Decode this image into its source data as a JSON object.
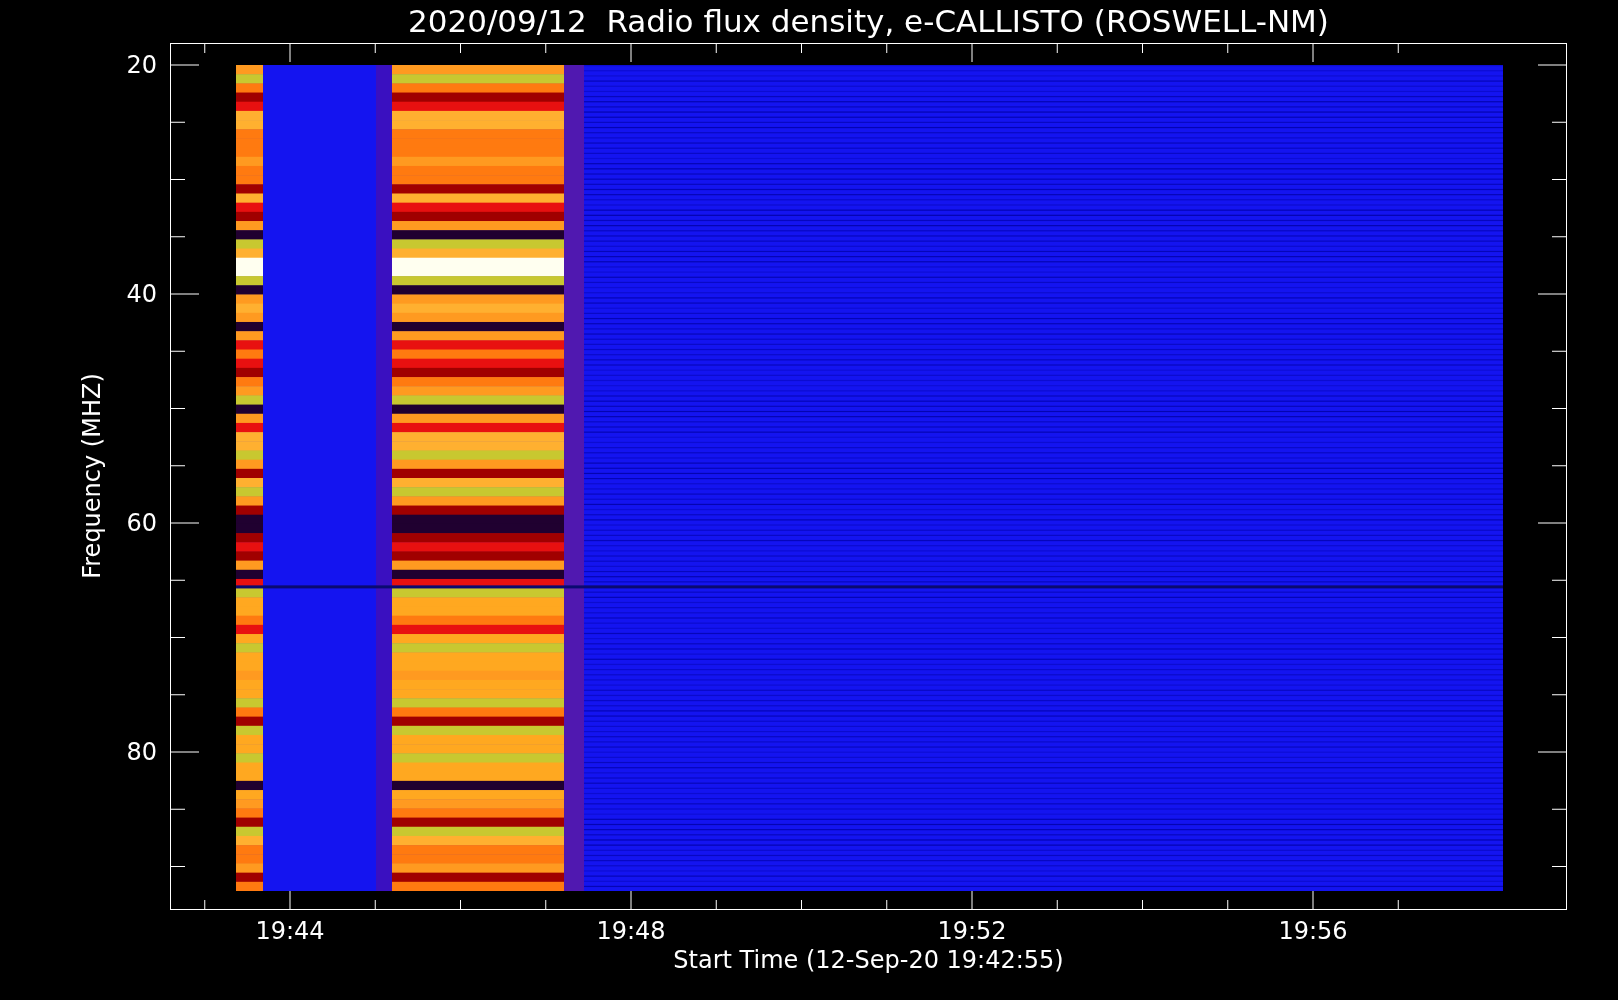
{
  "title": "2020/09/12  Radio flux density, e-CALLISTO (ROSWELL-NM)",
  "y_axis": {
    "label": "Frequency (MHZ)",
    "ticks": [
      "20",
      "40",
      "60",
      "80"
    ]
  },
  "x_axis": {
    "label": "Start Time (12-Sep-20 19:42:55)",
    "ticks": [
      "19:44",
      "19:48",
      "19:52",
      "19:56"
    ]
  }
}
